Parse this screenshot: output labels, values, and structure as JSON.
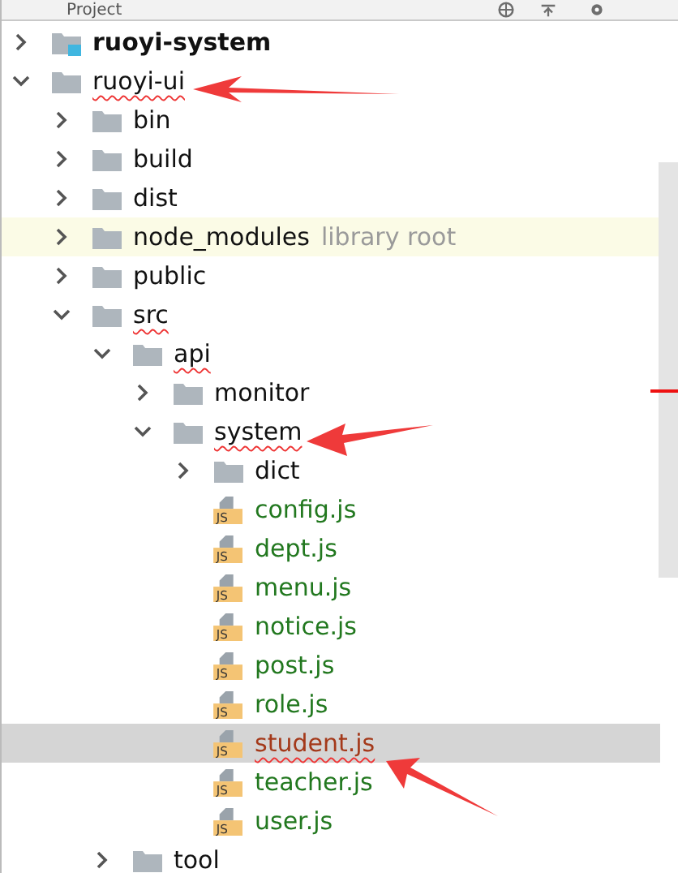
{
  "header": {
    "title": "Project"
  },
  "tree": [
    {
      "name": "ruoyi-system",
      "kind": "module",
      "expanded": false,
      "selected": false,
      "misspelled": false
    },
    {
      "name": "ruoyi-ui",
      "kind": "folder",
      "expanded": true,
      "selected": false,
      "misspelled": true,
      "children": [
        {
          "name": "bin",
          "kind": "folder",
          "expanded": false,
          "selected": false,
          "misspelled": false
        },
        {
          "name": "build",
          "kind": "folder",
          "expanded": false,
          "selected": false,
          "misspelled": false
        },
        {
          "name": "dist",
          "kind": "folder",
          "expanded": false,
          "selected": false,
          "misspelled": false
        },
        {
          "name": "node_modules",
          "hint": "library root",
          "kind": "folder",
          "expanded": false,
          "selected": false,
          "misspelled": false
        },
        {
          "name": "public",
          "kind": "folder",
          "expanded": false,
          "selected": false,
          "misspelled": false
        },
        {
          "name": "src",
          "kind": "folder",
          "expanded": true,
          "selected": false,
          "misspelled": true,
          "children": [
            {
              "name": "api",
              "kind": "folder",
              "expanded": true,
              "selected": false,
              "misspelled": true,
              "children": [
                {
                  "name": "monitor",
                  "kind": "folder",
                  "expanded": false,
                  "selected": false,
                  "misspelled": false
                },
                {
                  "name": "system",
                  "kind": "folder",
                  "expanded": true,
                  "selected": false,
                  "misspelled": true,
                  "children": [
                    {
                      "name": "dict",
                      "kind": "folder",
                      "expanded": false,
                      "selected": false,
                      "misspelled": false
                    },
                    {
                      "name": "config.js",
                      "kind": "js",
                      "icon_text": "JS",
                      "selected": false,
                      "misspelled": false,
                      "color": "#22781f"
                    },
                    {
                      "name": "dept.js",
                      "kind": "js",
                      "icon_text": "JS",
                      "selected": false,
                      "misspelled": false,
                      "color": "#22781f"
                    },
                    {
                      "name": "menu.js",
                      "kind": "js",
                      "icon_text": "JS",
                      "selected": false,
                      "misspelled": false,
                      "color": "#22781f"
                    },
                    {
                      "name": "notice.js",
                      "kind": "js",
                      "icon_text": "JS",
                      "selected": false,
                      "misspelled": false,
                      "color": "#22781f"
                    },
                    {
                      "name": "post.js",
                      "kind": "js",
                      "icon_text": "JS",
                      "selected": false,
                      "misspelled": false,
                      "color": "#22781f"
                    },
                    {
                      "name": "role.js",
                      "kind": "js",
                      "icon_text": "JS",
                      "selected": false,
                      "misspelled": false,
                      "color": "#22781f"
                    },
                    {
                      "name": "student.js",
                      "kind": "js",
                      "icon_text": "JS",
                      "selected": true,
                      "misspelled": true,
                      "color": "#a4391a"
                    },
                    {
                      "name": "teacher.js",
                      "kind": "js",
                      "icon_text": "JS",
                      "selected": false,
                      "misspelled": false,
                      "color": "#22781f"
                    },
                    {
                      "name": "user.js",
                      "kind": "js",
                      "icon_text": "JS",
                      "selected": false,
                      "misspelled": false,
                      "color": "#22781f"
                    }
                  ]
                }
              ]
            },
            {
              "name": "tool",
              "kind": "folder",
              "expanded": false,
              "selected": false,
              "misspelled": false
            }
          ]
        }
      ]
    }
  ]
}
